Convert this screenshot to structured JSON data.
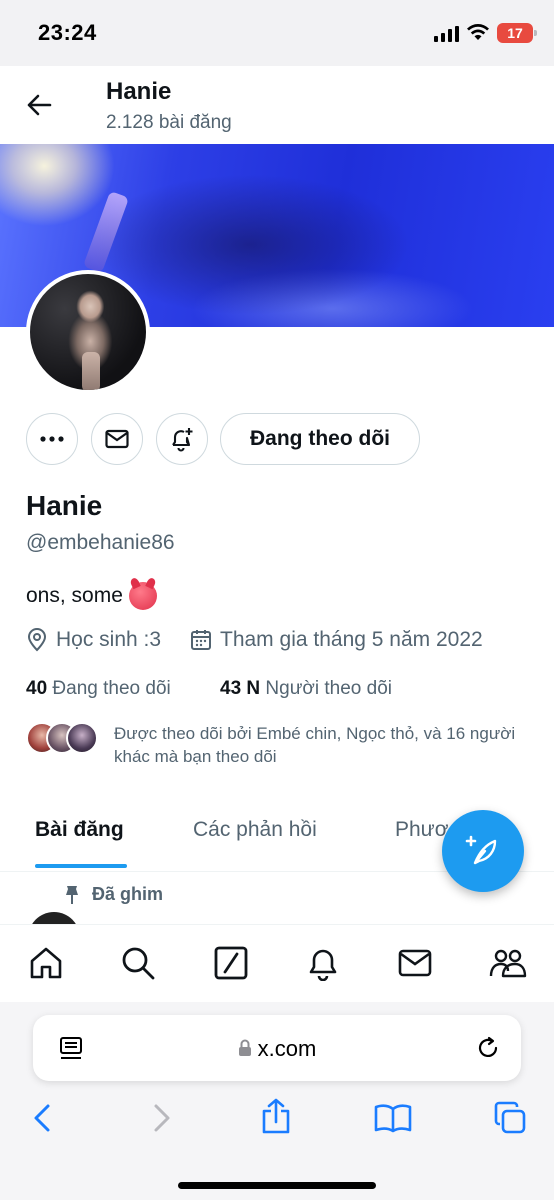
{
  "status_bar": {
    "time": "23:24",
    "battery": "17"
  },
  "header": {
    "name": "Hanie",
    "post_count": "2.128 bài đăng"
  },
  "profile": {
    "name": "Hanie",
    "handle": "@embehanie86",
    "bio": "ons, some",
    "location": "Học sinh :3",
    "joined": "Tham gia tháng 5 năm 2022",
    "following_count": "40",
    "following_label": "Đang theo dõi",
    "followers_count": "43 N",
    "followers_label": "Người theo dõi",
    "followed_by": "Được theo dõi bởi Embé chin, Ngọc thỏ, và 16 người khác mà bạn theo dõi"
  },
  "actions": {
    "follow_label": "Đang theo dõi"
  },
  "tabs": [
    {
      "label": "Bài đăng",
      "active": true
    },
    {
      "label": "Các phản hồi",
      "active": false
    },
    {
      "label": "Phươ",
      "active": false
    }
  ],
  "pinned_label": "Đã ghim",
  "browser": {
    "url": "x.com"
  },
  "colors": {
    "accent": "#1d9bf0",
    "text": "#0f1419",
    "muted": "#536471",
    "banner": "#2d3fe6"
  },
  "icons": {
    "nav": [
      "home-icon",
      "search-icon",
      "grok-icon",
      "bell-icon",
      "mail-icon",
      "communities-icon"
    ],
    "safari": [
      "back-icon",
      "forward-icon",
      "share-icon",
      "bookmarks-icon",
      "tabs-icon"
    ]
  }
}
